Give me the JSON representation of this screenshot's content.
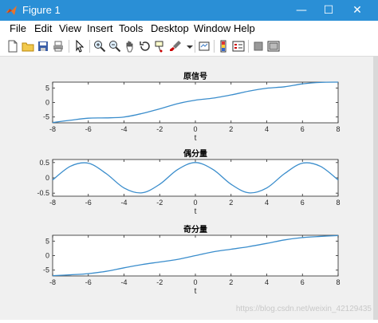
{
  "window": {
    "title": "Figure 1",
    "controls": [
      "—",
      "☐",
      "✕"
    ],
    "accent": "#2a8fd6"
  },
  "menu": [
    "File",
    "Edit",
    "View",
    "Insert",
    "Tools",
    "Desktop",
    "Window",
    "Help"
  ],
  "toolbar": [
    "new-figure-icon",
    "open-icon",
    "save-icon",
    "print-icon",
    "pointer-icon",
    "zoom-in-icon",
    "zoom-out-icon",
    "pan-icon",
    "rotate-icon",
    "data-cursor-icon",
    "brush-icon",
    "link-icon",
    "colorbar-icon",
    "legend-icon",
    "hide-plot-tools-icon",
    "show-plot-tools-icon"
  ],
  "watermark": "https://blog.csdn.net/weixin_42129435",
  "chart_data": [
    {
      "type": "line",
      "title": "原信号",
      "xlabel": "t",
      "ylabel": "",
      "xlim": [
        -8,
        8
      ],
      "ylim": [
        -7,
        7
      ],
      "xticks": [
        "-8",
        "-6",
        "-4",
        "-2",
        "0",
        "2",
        "4",
        "6",
        "8"
      ],
      "yticks": [
        "5",
        "0",
        "-5"
      ],
      "series": [
        {
          "color": "#3a8dcc",
          "x": [
            -8,
            -7,
            -6,
            -5,
            -4,
            -3,
            -2,
            -1,
            0,
            1,
            2,
            3,
            4,
            5,
            6,
            7,
            8
          ],
          "values": [
            -6.9,
            -6.1,
            -5.4,
            -5.3,
            -5.0,
            -3.8,
            -2.2,
            -0.4,
            0.8,
            1.5,
            2.6,
            3.9,
            4.9,
            5.4,
            6.4,
            6.9,
            7.0
          ]
        }
      ]
    },
    {
      "type": "line",
      "title": "偶分量",
      "xlabel": "t",
      "ylabel": "",
      "xlim": [
        -8,
        8
      ],
      "ylim": [
        -0.6,
        0.6
      ],
      "xticks": [
        "-8",
        "-6",
        "-4",
        "-2",
        "0",
        "2",
        "4",
        "6",
        "8"
      ],
      "yticks": [
        "0.5",
        "0",
        "-0.5"
      ],
      "series": [
        {
          "color": "#3a8dcc",
          "x": [
            -8,
            -7,
            -6,
            -5,
            -4,
            -3,
            -2,
            -1,
            0,
            1,
            2,
            3,
            4,
            5,
            6,
            7,
            8
          ],
          "values": [
            -0.07,
            0.38,
            0.48,
            0.14,
            -0.33,
            -0.49,
            -0.21,
            0.27,
            0.5,
            0.27,
            -0.21,
            -0.49,
            -0.33,
            0.14,
            0.48,
            0.38,
            -0.07
          ]
        }
      ]
    },
    {
      "type": "line",
      "title": "奇分量",
      "xlabel": "t",
      "ylabel": "",
      "xlim": [
        -8,
        8
      ],
      "ylim": [
        -7,
        7
      ],
      "xticks": [
        "-8",
        "-6",
        "-4",
        "-2",
        "0",
        "2",
        "4",
        "6",
        "8"
      ],
      "yticks": [
        "5",
        "0",
        "-5"
      ],
      "series": [
        {
          "color": "#3a8dcc",
          "x": [
            -8,
            -7,
            -6,
            -5,
            -4,
            -3,
            -2,
            -1,
            0,
            1,
            2,
            3,
            4,
            5,
            6,
            7,
            8
          ],
          "values": [
            -6.9,
            -6.6,
            -6.2,
            -5.4,
            -4.2,
            -3.1,
            -2.2,
            -1.3,
            0.0,
            1.3,
            2.2,
            3.1,
            4.2,
            5.4,
            6.2,
            6.6,
            6.9
          ]
        }
      ]
    }
  ]
}
